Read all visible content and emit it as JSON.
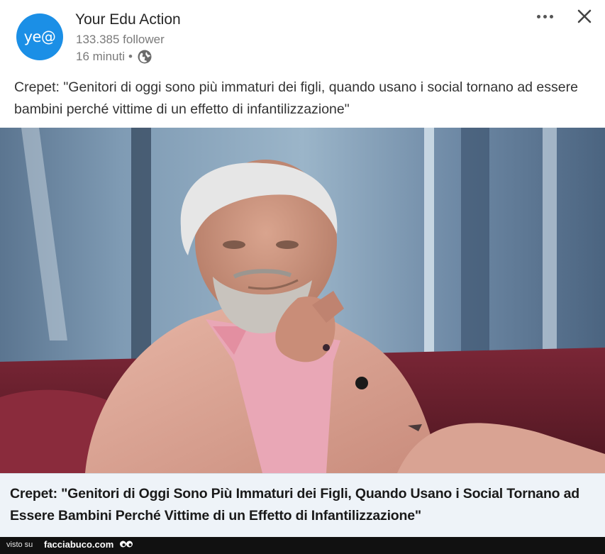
{
  "post": {
    "author": {
      "avatar_text": "ye@",
      "name": "Your Edu Action",
      "followers": "133.385 follower",
      "time": "16 minuti",
      "separator": "•",
      "visibility_icon": "globe-icon"
    },
    "controls": {
      "more_icon": "more-horizontal-icon",
      "close_icon": "close-icon"
    },
    "text": "Crepet: \"Genitori di oggi sono più immaturi dei figli, quando usano i social tornano ad essere bambini perché vittime di un effetto di infantilizzazione\"",
    "link_card": {
      "title": "Crepet: \"Genitori di Oggi Sono Più Immaturi dei Figli, Quando Usano i Social Tornano ad Essere Bambini Perché Vittime di un Effetto di Infantilizzazione\""
    }
  },
  "footer": {
    "visto_su": "visto su",
    "site": "facciabuco.com"
  },
  "colors": {
    "avatar_bg": "#1b8fe6",
    "link_card_bg": "#eef3f8",
    "footer_bg": "#111111"
  }
}
